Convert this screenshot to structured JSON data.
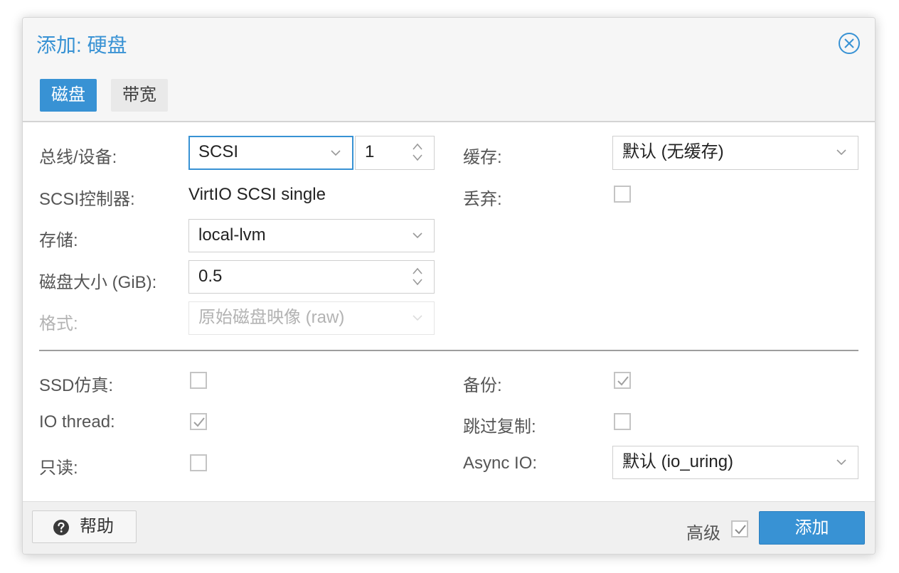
{
  "dialog": {
    "title": "添加: 硬盘",
    "close_icon": "close-circle-icon",
    "accent_color": "#3892d4"
  },
  "tabs": [
    {
      "label": "磁盘",
      "active": true
    },
    {
      "label": "带宽",
      "active": false
    }
  ],
  "left": {
    "bus_device": {
      "label": "总线/设备:",
      "bus": "SCSI",
      "device": "1"
    },
    "scsi_controller": {
      "label": "SCSI控制器:",
      "value": "VirtIO SCSI single"
    },
    "storage": {
      "label": "存储:",
      "value": "local-lvm"
    },
    "disk_size": {
      "label": "磁盘大小 (GiB):",
      "value": "0.5"
    },
    "format": {
      "label": "格式:",
      "value": "原始磁盘映像 (raw)",
      "disabled": true
    }
  },
  "right": {
    "cache": {
      "label": "缓存:",
      "value": "默认 (无缓存)"
    },
    "discard": {
      "label": "丢弃:",
      "checked": false
    }
  },
  "advanced": {
    "ssd_emulation": {
      "label": "SSD仿真:",
      "checked": false
    },
    "io_thread": {
      "label": "IO thread:",
      "checked": true
    },
    "read_only": {
      "label": "只读:",
      "checked": false
    },
    "backup": {
      "label": "备份:",
      "checked": true
    },
    "skip_replication": {
      "label": "跳过复制:",
      "checked": false
    },
    "async_io": {
      "label": "Async IO:",
      "value": "默认 (io_uring)"
    }
  },
  "footer": {
    "help_label": "帮助",
    "help_icon": "question-circle-icon",
    "advanced_label": "高级",
    "advanced_checked": true,
    "add_label": "添加"
  }
}
